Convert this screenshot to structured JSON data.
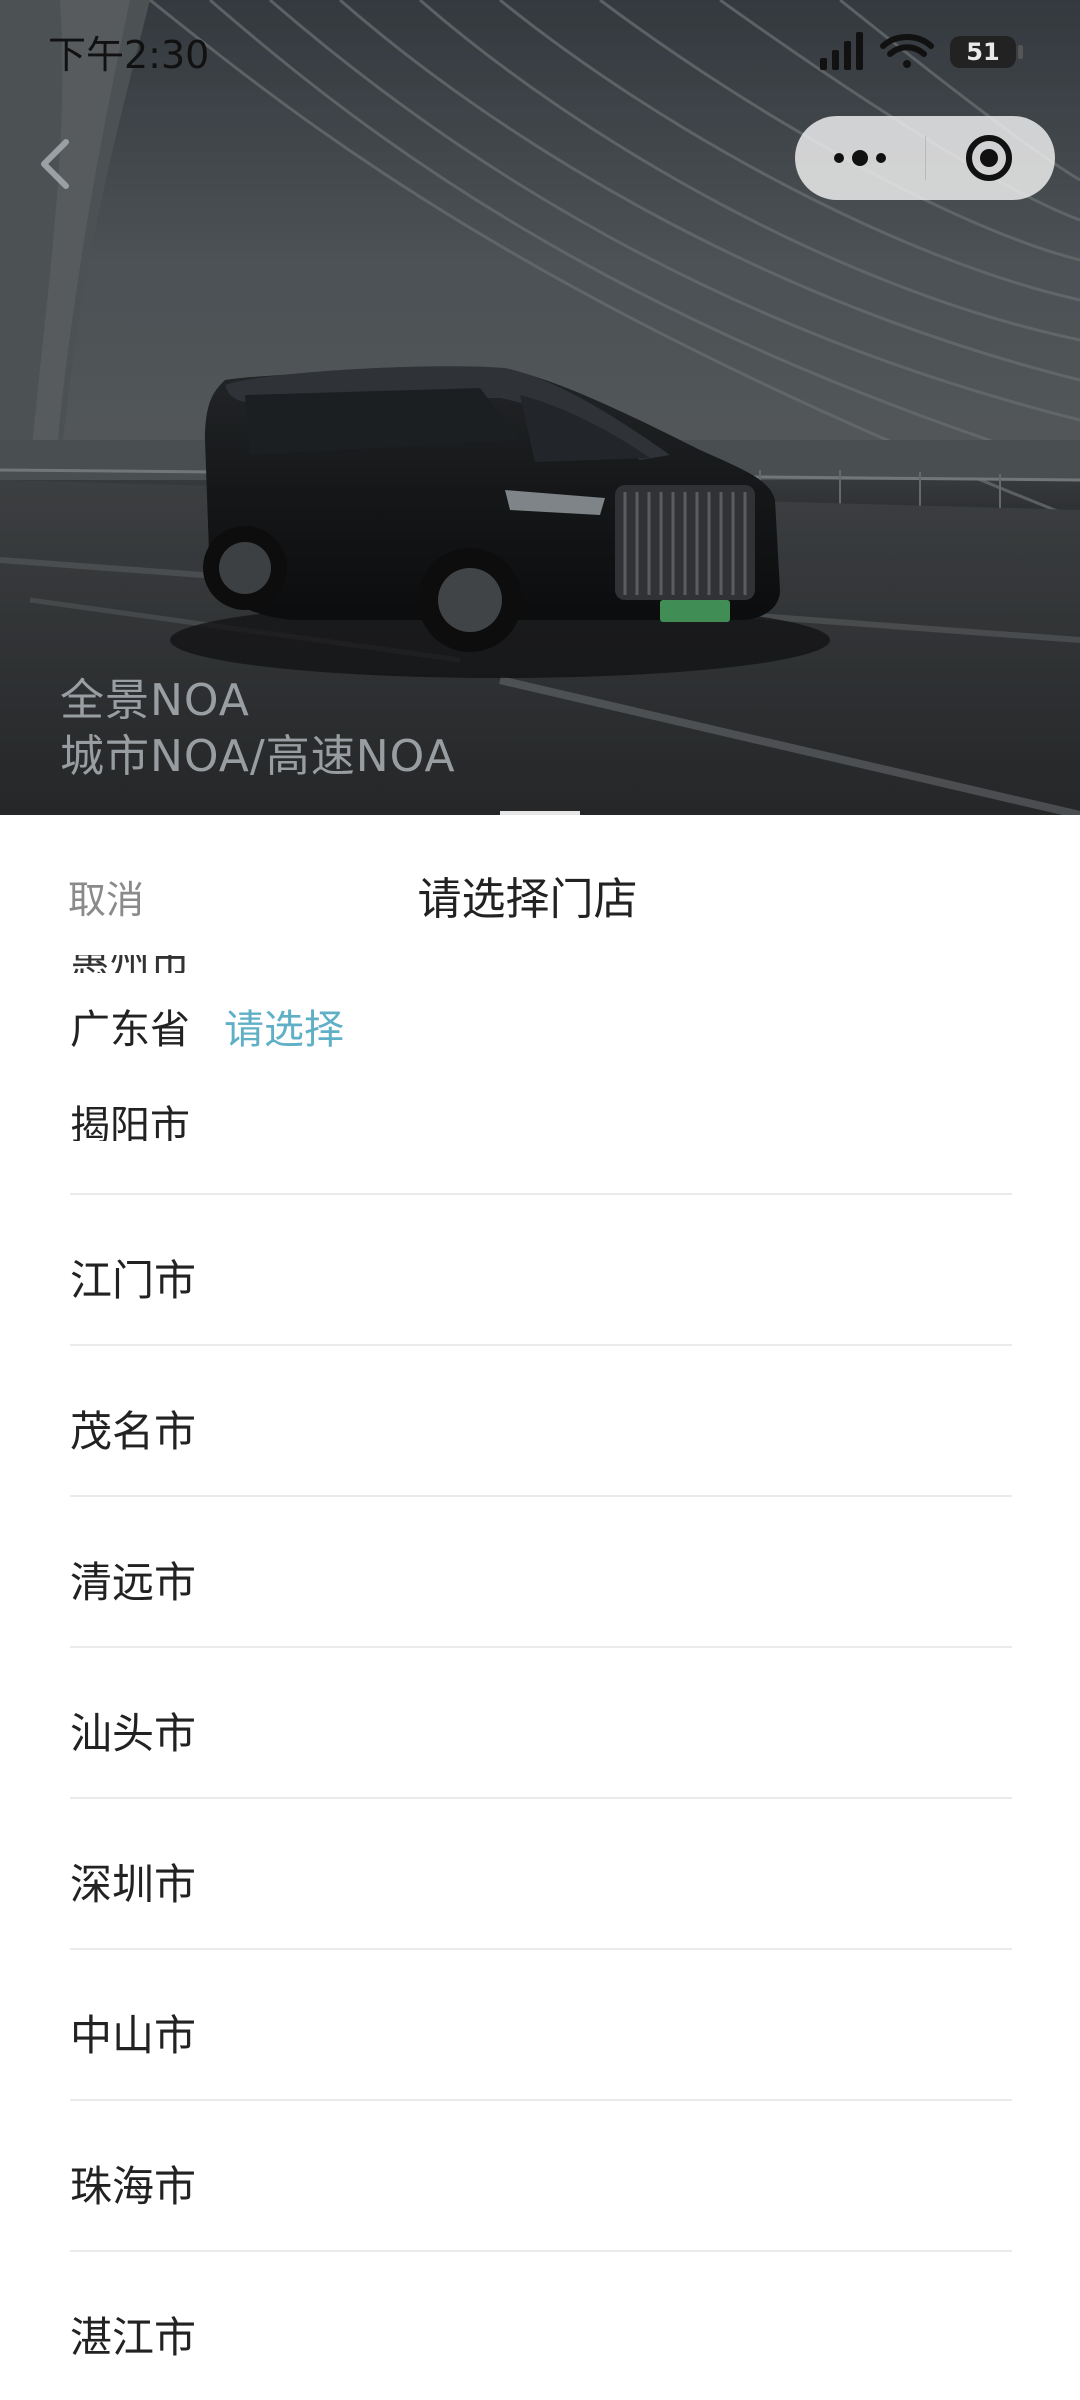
{
  "status_bar": {
    "time": "下午2:30",
    "battery": "51"
  },
  "banner": {
    "line1": "全景NOA",
    "line2": "城市NOA/高速NOA"
  },
  "sheet": {
    "cancel_label": "取消",
    "title": "请选择门店",
    "province": "广东省",
    "select_prompt": "请选择",
    "partial_top": "惠州市",
    "partial_item": "揭阳市",
    "cities": [
      {
        "label": "江门市"
      },
      {
        "label": "茂名市"
      },
      {
        "label": "清远市"
      },
      {
        "label": "汕头市"
      },
      {
        "label": "深圳市"
      },
      {
        "label": "中山市"
      },
      {
        "label": "珠海市"
      },
      {
        "label": "湛江市"
      }
    ]
  },
  "colors": {
    "accent": "#5fb0c7",
    "text": "#222222",
    "muted": "#8a8a8a",
    "divider": "#ebebeb"
  },
  "icons": {
    "back": "back-icon",
    "more": "more-icon",
    "close": "target-close-icon",
    "signal": "signal-icon",
    "wifi": "wifi-icon",
    "battery": "battery-icon"
  }
}
